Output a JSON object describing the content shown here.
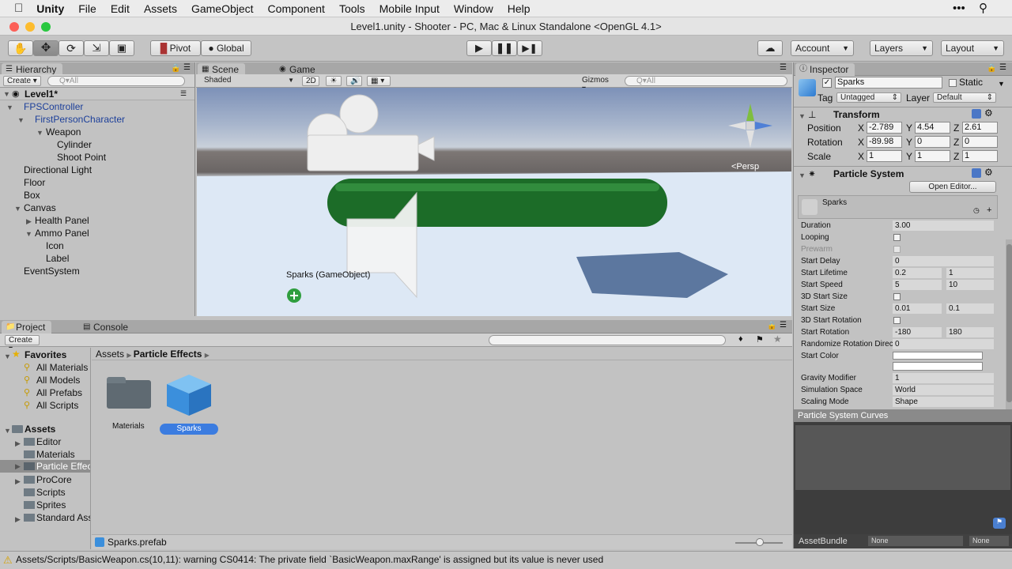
{
  "menubar": {
    "app": "Unity",
    "items": [
      "File",
      "Edit",
      "Assets",
      "GameObject",
      "Component",
      "Tools",
      "Mobile Input",
      "Window",
      "Help"
    ]
  },
  "window": {
    "title": "Level1.unity - Shooter - PC, Mac & Linux Standalone <OpenGL 4.1>"
  },
  "toolbar": {
    "pivot": "Pivot",
    "global": "Global",
    "account": "Account",
    "layers": "Layers",
    "layout": "Layout"
  },
  "hierarchy": {
    "tab": "Hierarchy",
    "create": "Create",
    "search": "Q▾All",
    "scene": "Level1*",
    "items": [
      "FPSController",
      "FirstPersonCharacter",
      "Weapon",
      "Cylinder",
      "Shoot Point",
      "Directional Light",
      "Floor",
      "Box",
      "Canvas",
      "Health Panel",
      "Ammo Panel",
      "Icon",
      "Label",
      "EventSystem"
    ]
  },
  "scene": {
    "tab_scene": "Scene",
    "tab_game": "Game",
    "shaded": "Shaded",
    "mode2d": "2D",
    "gizmos": "Gizmos",
    "search": "Q▾All",
    "persp": "<Persp",
    "tooltip": "Sparks (GameObject)"
  },
  "project": {
    "tab_project": "Project",
    "tab_console": "Console",
    "create": "Create",
    "breadcrumb": [
      "Assets",
      "Particle Effects"
    ],
    "favorites_label": "Favorites",
    "favorites": [
      "All Materials",
      "All Models",
      "All Prefabs",
      "All Scripts"
    ],
    "assets_label": "Assets",
    "folders": [
      "Editor",
      "Materials",
      "Particle Effec",
      "ProCore",
      "Scripts",
      "Sprites",
      "Standard Ass"
    ],
    "grid_items": [
      "Materials",
      "Sparks"
    ],
    "footer": "Sparks.prefab"
  },
  "inspector": {
    "tab": "Inspector",
    "name": "Sparks",
    "static": "Static",
    "tag_label": "Tag",
    "tag": "Untagged",
    "layer_label": "Layer",
    "layer": "Default",
    "transform": "Transform",
    "position": "Position",
    "rotation": "Rotation",
    "scale": "Scale",
    "pos": [
      "-2.789",
      "4.54",
      "2.61"
    ],
    "rot": [
      "-89.98",
      "0",
      "0"
    ],
    "scl": [
      "1",
      "1",
      "1"
    ],
    "particle_system": "Particle System",
    "open_editor": "Open Editor...",
    "module": "Sparks",
    "props": [
      {
        "l": "Duration",
        "v": "3.00"
      },
      {
        "l": "Looping",
        "v": ""
      },
      {
        "l": "Prewarm",
        "v": ""
      },
      {
        "l": "Start Delay",
        "v": "0"
      },
      {
        "l": "Start Lifetime",
        "v": "0.2",
        "v2": "1"
      },
      {
        "l": "Start Speed",
        "v": "5",
        "v2": "10"
      },
      {
        "l": "3D Start Size",
        "v": ""
      },
      {
        "l": "Start Size",
        "v": "0.01",
        "v2": "0.1"
      },
      {
        "l": "3D Start Rotation",
        "v": ""
      },
      {
        "l": "Start Rotation",
        "v": "-180",
        "v2": "180"
      },
      {
        "l": "Randomize Rotation Direc",
        "v": "0"
      },
      {
        "l": "Start Color",
        "v": ""
      },
      {
        "l": "",
        "v": ""
      },
      {
        "l": "Gravity Modifier",
        "v": "1"
      },
      {
        "l": "Simulation Space",
        "v": "World"
      },
      {
        "l": "Scaling Mode",
        "v": "Shape"
      }
    ],
    "curves": "Particle System Curves",
    "assetbundle": "AssetBundle",
    "ab_none1": "None",
    "ab_none2": "None"
  },
  "status": {
    "text": "Assets/Scripts/BasicWeapon.cs(10,11): warning CS0414: The private field `BasicWeapon.maxRange' is assigned but its value is never used"
  }
}
